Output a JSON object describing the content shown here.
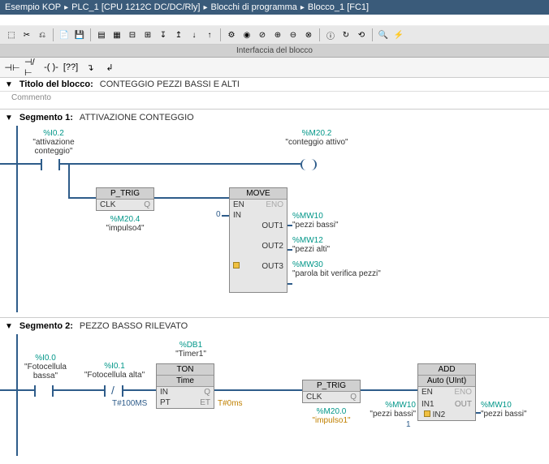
{
  "breadcrumb": {
    "root": "Esempio KOP",
    "plc": "PLC_1 [CPU 1212C DC/DC/Rly]",
    "folder": "Blocchi di programma",
    "block": "Blocco_1 [FC1]"
  },
  "interface_bar": "Interfaccia del blocco",
  "block_title": {
    "label": "Titolo del blocco:",
    "value": "CONTEGGIO PEZZI BASSI E ALTI",
    "comment": "Commento"
  },
  "segment1": {
    "label": "Segmento 1:",
    "desc": "ATTIVAZIONE CONTEGGIO",
    "contact1": {
      "addr": "%I0.2",
      "sym": "\"attivazione conteggio\""
    },
    "coil1": {
      "addr": "%M20.2",
      "sym": "\"conteggio attivo\""
    },
    "ptrig": {
      "title": "P_TRIG",
      "clk": "CLK",
      "q": "Q",
      "below_addr": "%M20.4",
      "below_sym": "\"impulso4\""
    },
    "move": {
      "title": "MOVE",
      "en": "EN",
      "eno": "ENO",
      "in": "IN",
      "in_val": "0",
      "outs": [
        {
          "port": "OUT1",
          "addr": "%MW10",
          "sym": "\"pezzi bassi\""
        },
        {
          "port": "OUT2",
          "addr": "%MW12",
          "sym": "\"pezzi alti\""
        },
        {
          "port": "OUT3",
          "addr": "%MW30",
          "sym": "\"parola bit verifica pezzi\""
        }
      ]
    }
  },
  "segment2": {
    "label": "Segmento 2:",
    "desc": "PEZZO BASSO RILEVATO",
    "contact1": {
      "addr": "%I0.0",
      "sym": "\"Fotocellula bassa\""
    },
    "contact2": {
      "addr": "%I0.1",
      "sym": "\"Fotocellula alta\""
    },
    "db": {
      "addr": "%DB1",
      "sym": "\"Timer1\""
    },
    "ton": {
      "title": "TON",
      "sub": "Time",
      "in": "IN",
      "q": "Q",
      "pt": "PT",
      "et": "ET",
      "pt_val": "T#100MS",
      "et_val": "T#0ms"
    },
    "ptrig": {
      "title": "P_TRIG",
      "clk": "CLK",
      "q": "Q",
      "below_addr": "%M20.0",
      "below_sym": "\"impulso1\""
    },
    "add": {
      "title": "ADD",
      "sub": "Auto (UInt)",
      "en": "EN",
      "eno": "ENO",
      "in1": {
        "port": "IN1",
        "addr": "%MW10",
        "sym": "\"pezzi bassi\""
      },
      "in2": {
        "port": "IN2",
        "val": "1"
      },
      "out": {
        "port": "OUT",
        "addr": "%MW10",
        "sym": "\"pezzi bassi\""
      }
    }
  }
}
